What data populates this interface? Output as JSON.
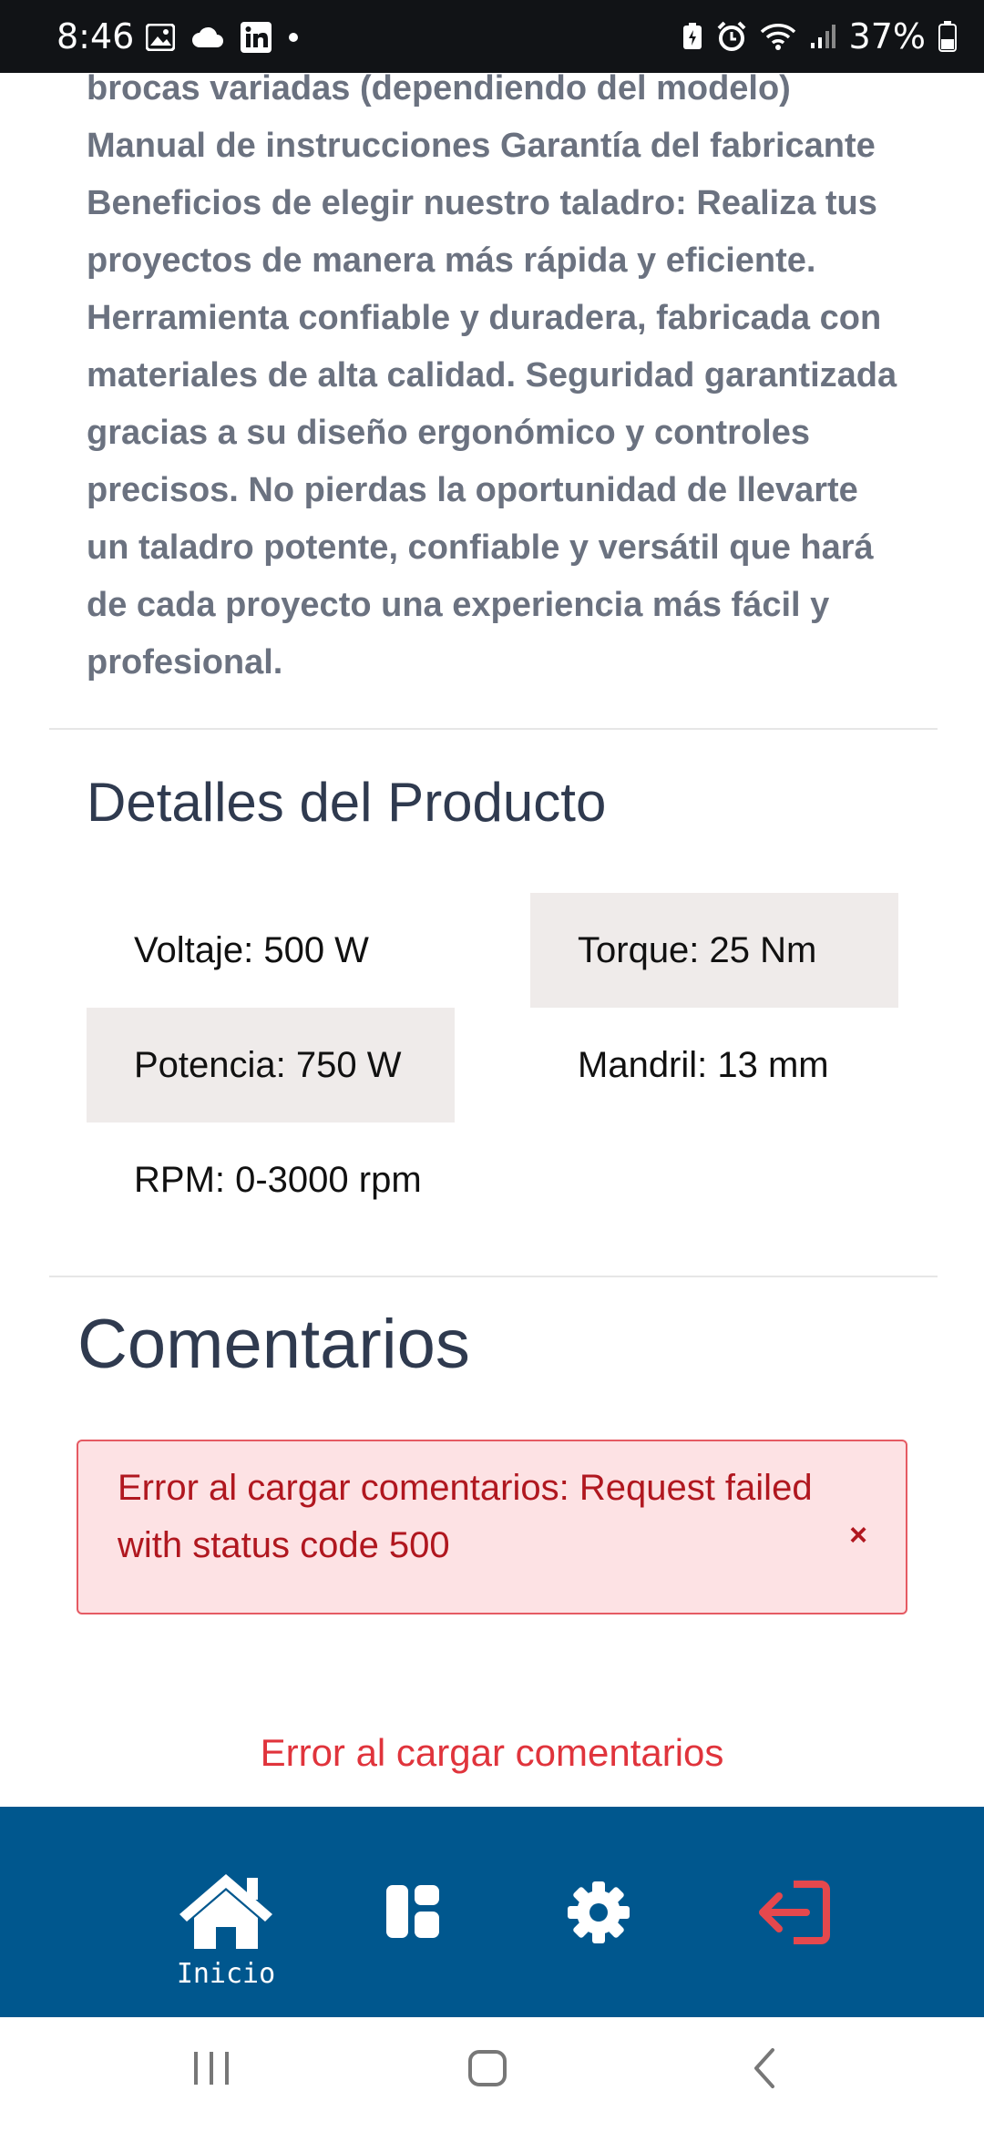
{
  "status_bar": {
    "time": "8:46",
    "battery": "37%",
    "icons": [
      "image-icon",
      "cloud-icon",
      "linkedin-icon",
      "dot-icon",
      "battery-saver-icon",
      "alarm-icon",
      "wifi-icon",
      "signal-icon",
      "battery-icon"
    ]
  },
  "product": {
    "description": "brocas variadas (dependiendo del modelo) Manual de instrucciones Garantía del fabricante Beneficios de elegir nuestro taladro: Realiza tus proyectos de manera más rápida y eficiente. Herramienta confiable y duradera, fabricada con materiales de alta calidad. Seguridad garantizada gracias a su diseño ergonómico y controles precisos. No pierdas la oportunidad de llevarte un taladro potente, confiable y versátil que hará de cada proyecto una experiencia más fácil y profesional.",
    "details_title": "Detalles del Producto",
    "specs": [
      "Voltaje: 500 W",
      "Torque: 25 Nm",
      "Potencia: 750 W",
      "Mandril: 13 mm",
      "RPM: 0-3000 rpm"
    ]
  },
  "comments": {
    "title": "Comentarios",
    "alert_message": "Error al cargar comentarios: Request failed with status code 500",
    "alert_close": "×",
    "error_text": "Error al cargar comentarios"
  },
  "bottom_nav": {
    "items": [
      {
        "icon": "home-icon",
        "label": "Inicio"
      },
      {
        "icon": "dashboard-icon",
        "label": ""
      },
      {
        "icon": "gear-icon",
        "label": ""
      },
      {
        "icon": "logout-icon",
        "label": ""
      }
    ],
    "colors": {
      "background": "#00578e",
      "logout": "#e5484d"
    }
  },
  "system_nav": {
    "icons": [
      "recent-apps-icon",
      "home-button-icon",
      "back-icon"
    ]
  }
}
